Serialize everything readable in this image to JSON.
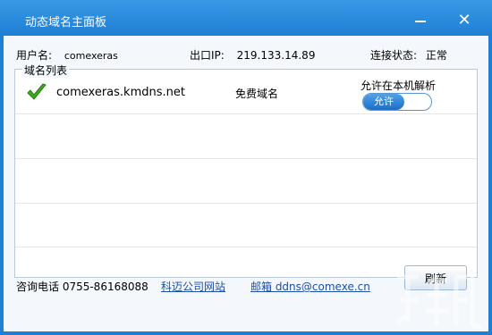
{
  "window": {
    "title": "动态域名主面板",
    "minimize_icon": "minimize-icon",
    "close_icon": "close-icon",
    "close_glyph": "✕"
  },
  "info": {
    "username_label": "用户名:",
    "username_value": "comexeras",
    "ip_label": "出口IP:",
    "ip_value": "219.133.14.89",
    "status_label": "连接状态:",
    "status_value": "正常"
  },
  "domain_list": {
    "title": "域名列表",
    "rows": [
      {
        "icon": "checkmark-icon",
        "domain": "comexeras.kmdns.net",
        "type": "免费域名",
        "resolve_label": "允许在本机解析",
        "toggle_label": "允许"
      }
    ]
  },
  "footer": {
    "hotline": "咨询电话 0755-86168088",
    "company_link": "科迈公司网站",
    "email_link": "邮箱 ddns@comexe.cn",
    "refresh_label": "刷新"
  },
  "colors": {
    "titlebar": "#1e7fd4",
    "link": "#1b4fa5",
    "check": "#3fa81f"
  }
}
